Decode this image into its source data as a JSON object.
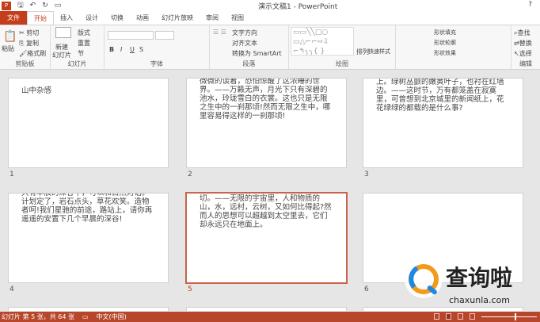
{
  "title": "演示文稿1 - PowerPoint",
  "tabs": [
    "文件",
    "开始",
    "插入",
    "设计",
    "切换",
    "动画",
    "幻灯片放映",
    "审阅",
    "视图"
  ],
  "ribbon": {
    "clipboard": {
      "paste": "粘贴",
      "cut": "剪切",
      "copy": "复制",
      "format_painter": "格式刷",
      "label": "剪贴板"
    },
    "slides": {
      "new_slide_1": "新建",
      "new_slide_2": "幻灯片",
      "layout": "版式",
      "reset": "重置",
      "section": "节",
      "label": "幻灯片"
    },
    "font": {
      "bold": "B",
      "italic": "I",
      "underline": "U",
      "shadow": "S",
      "label": "字体"
    },
    "paragraph": {
      "text_direction": "文字方向",
      "align_text": "对齐文本",
      "smartart": "转换为 SmartArt",
      "label": "段落"
    },
    "drawing": {
      "arrange": "排列",
      "quick_styles": "快速样式",
      "shape_fill": "形状填充",
      "shape_outline": "形状轮廓",
      "shape_effects": "形状效果",
      "label": "绘图"
    },
    "editing": {
      "find": "查找",
      "replace": "替换",
      "select": "选择",
      "label": "编辑"
    }
  },
  "slides": [
    {
      "num": "1",
      "text": "山中杂感"
    },
    {
      "num": "2",
      "text": "微微的谈着，恐怕惊醒了这浓睡的世界。——万籁无声，月光下只有深碧的池水，玲珑雪白的衣裳。这也只是无限之生中的一刹那顷!然而无限之生中，哪里容易得这样的一刹那顷!"
    },
    {
      "num": "3",
      "text": "上。绿树丛颤的嫩黄叶子，也衬在红墙边。——这时节，万有都笼盖在寂寞里，可曾想到北京城里的新闻纸上，花花绿绿的都载的是什么事?"
    },
    {
      "num": "4",
      "text": "只有早晨的深谷中，可以和自然对话。计划定了，岩石点头，草花欢笑。造物者呵!我们星驰的前途，路站上，请你再遥遥的安置下几个早晨的深谷!"
    },
    {
      "num": "5",
      "text": "切。——无限的宇宙里，人和物质的山，水，远村，云树，又如何比得起?然而人的思想可以超越到太空里去，它们却永远只在地面上。"
    },
    {
      "num": "6",
      "text": ""
    }
  ],
  "status": {
    "slide_info": "幻灯片 第 5 张，共 64 张",
    "language": "中文(中国)"
  },
  "watermark": {
    "name": "查询啦",
    "url": "chaxunla.com"
  },
  "colors": {
    "accent": "#c43e1c",
    "status": "#b7472a",
    "selected_border": "#c9634a"
  }
}
